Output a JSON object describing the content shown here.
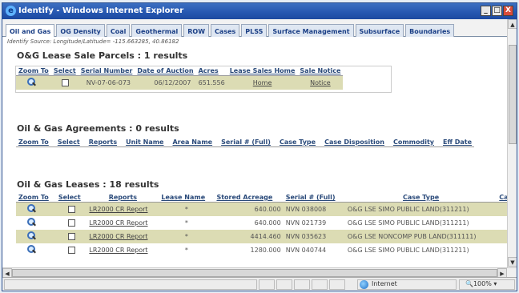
{
  "window": {
    "title": "Identify - Windows Internet Explorer",
    "minimize": "_",
    "maximize": "□",
    "close": "X"
  },
  "tabs": [
    "Oil and Gas",
    "OG Density",
    "Coal",
    "Geothermal",
    "ROW",
    "Cases",
    "PLSS",
    "Surface Management",
    "Subsurface",
    "Boundaries"
  ],
  "source": "Identify Source: Longitude/Latitude= -115.663285, 40.86182",
  "parcels": {
    "title": "O&G Lease Sale Parcels : 1 results",
    "headers": [
      "Zoom To",
      "Select",
      "Serial Number",
      "Date of Auction",
      "Acres",
      "Lease Sales Home",
      "Sale Notice"
    ],
    "rows": [
      {
        "serial": "NV-07-06-073",
        "date": "06/12/2007",
        "acres": "651.556",
        "home": "Home",
        "notice": "Notice"
      }
    ]
  },
  "agreements": {
    "title": "Oil & Gas Agreements : 0 results",
    "headers": [
      "Zoom To",
      "Select",
      "Reports",
      "Unit Name",
      "Area Name",
      "Serial # (Full)",
      "Case Type",
      "Case Disposition",
      "Commodity",
      "Eff Date"
    ]
  },
  "leases": {
    "title": "Oil & Gas Leases : 18 results",
    "headers": [
      "Zoom To",
      "Select",
      "Reports",
      "Lease Name",
      "Stored Acreage",
      "Serial # (Full)",
      "Case Type",
      "Ca"
    ],
    "rows": [
      {
        "report": "LR2000 CR Report",
        "name": "*",
        "acreage": "640.000",
        "serial": "NVN 038008",
        "type": "O&G LSE SIMO PUBLIC LAND(311211)"
      },
      {
        "report": "LR2000 CR Report",
        "name": "*",
        "acreage": "640.000",
        "serial": "NVN 021739",
        "type": "O&G LSE SIMO PUBLIC LAND(311211)"
      },
      {
        "report": "LR2000 CR Report",
        "name": "*",
        "acreage": "4414.460",
        "serial": "NVN 035623",
        "type": "O&G LSE NONCOMP PUB LAND(311111)"
      },
      {
        "report": "LR2000 CR Report",
        "name": "*",
        "acreage": "1280.000",
        "serial": "NVN 040744",
        "type": "O&G LSE SIMO PUBLIC LAND(311211)"
      }
    ]
  },
  "status": {
    "zone": "Internet",
    "zoom": "100%"
  }
}
